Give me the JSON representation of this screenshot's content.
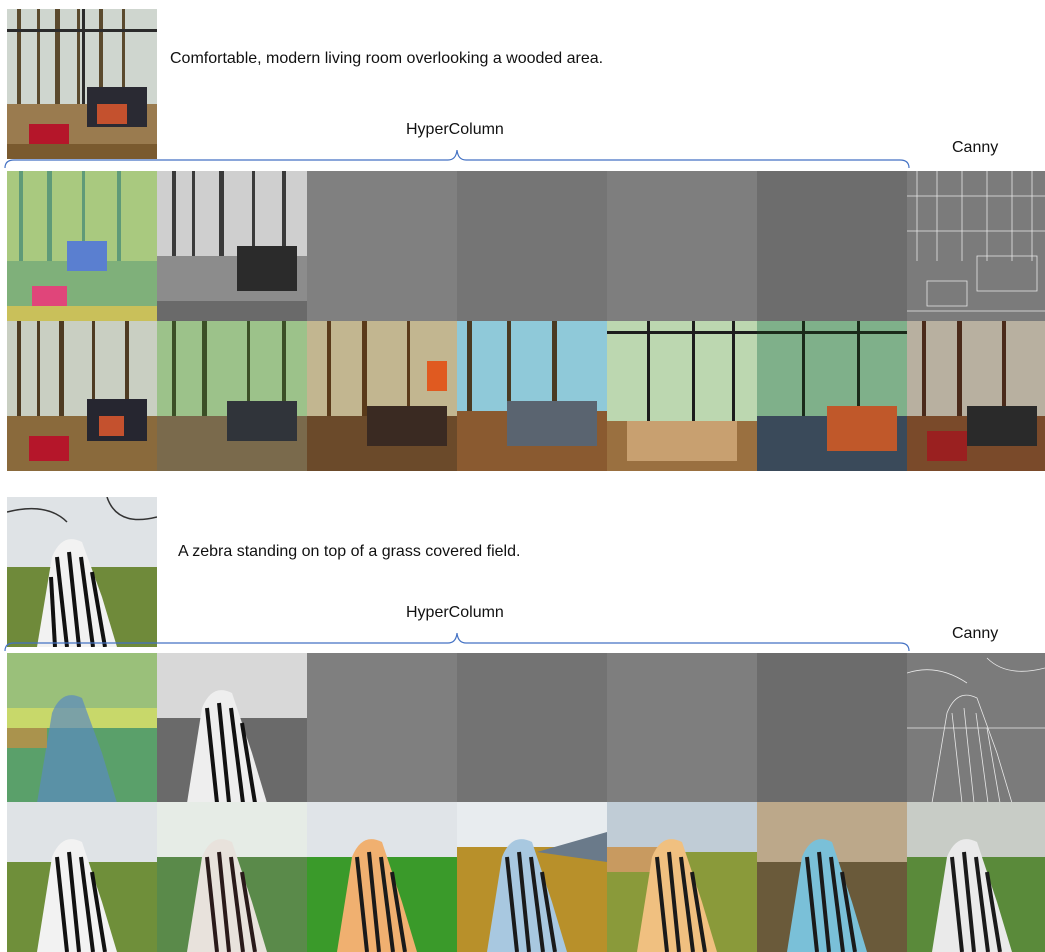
{
  "sections": [
    {
      "id": "living-room",
      "caption": "Comfortable, modern living room overlooking a wooded area.",
      "hypercolumn_label": "HyperColumn",
      "canny_label": "Canny",
      "feature_row": [
        "false-color feature map",
        "grayscale feature map",
        "high-frequency feature map",
        "high-frequency feature map",
        "flat feature map",
        "flat feature map",
        "canny edge map"
      ],
      "generated_row": [
        "original",
        "sample",
        "sample",
        "sample",
        "sample",
        "sample",
        "sample"
      ]
    },
    {
      "id": "zebra",
      "caption": "A zebra standing on top of a grass covered field.",
      "hypercolumn_label": "HyperColumn",
      "canny_label": "Canny",
      "feature_row": [
        "false-color feature map",
        "grayscale feature map",
        "high-frequency feature map",
        "high-frequency feature map",
        "flat feature map",
        "flat feature map",
        "canny edge map"
      ],
      "generated_row": [
        "original",
        "sample",
        "sample",
        "sample",
        "sample",
        "sample",
        "sample"
      ]
    }
  ],
  "palette": {
    "brace": "#4472c4",
    "gray_mid": "#7f7f7f",
    "gray_dark": "#6e6e6e",
    "wood": "#8a6a3c",
    "grass": "#6f8f3a",
    "sky": "#d9dde2"
  }
}
